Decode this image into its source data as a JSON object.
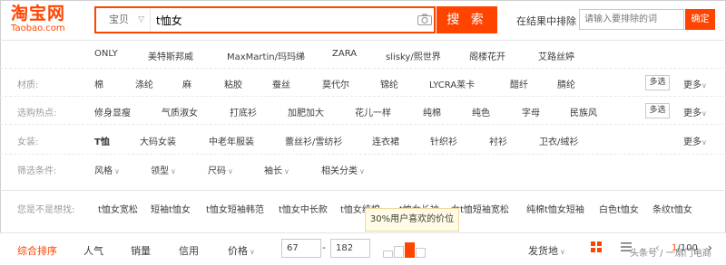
{
  "header": {
    "logo_main": "淘宝网",
    "logo_sub": "Taobao.com",
    "scope": "宝贝",
    "query": "t恤女",
    "search_label": "搜 索",
    "exclude_label": "在结果中排除",
    "exclude_placeholder": "请输入要排除的词",
    "exclude_confirm": "确定"
  },
  "brands": [
    "ONLY",
    "美特斯邦威",
    "MaxMartin/玛玛绨",
    "ZARA",
    "slisky/熙世界",
    "阁楼花开",
    "艾路丝婷"
  ],
  "material": {
    "label": "材质:",
    "items": [
      "棉",
      "涤纶",
      "麻",
      "粘胶",
      "蚕丝",
      "莫代尔",
      "锦纶",
      "LYCRA莱卡",
      "醋纤",
      "腈纶"
    ],
    "multi": "多选",
    "more": "更多"
  },
  "hot": {
    "label": "选购热点:",
    "items": [
      "修身显瘦",
      "气质淑女",
      "打底衫",
      "加肥加大",
      "花儿一样",
      "纯棉",
      "纯色",
      "字母",
      "民族风"
    ],
    "multi": "多选",
    "more": "更多"
  },
  "womens": {
    "label": "女装:",
    "items": [
      "T恤",
      "大码女装",
      "中老年服装",
      "蕾丝衫/雪纺衫",
      "连衣裙",
      "针织衫",
      "衬衫",
      "卫衣/绒衫"
    ],
    "more": "更多"
  },
  "conditions": {
    "label": "筛选条件:",
    "items": [
      "风格",
      "领型",
      "尺码",
      "袖长",
      "相关分类"
    ]
  },
  "suggest": {
    "label": "您是不是想找:",
    "items": [
      "t恤女宽松",
      "短袖t恤女",
      "t恤女短袖韩范",
      "t恤女中长款",
      "t恤女纯棉",
      "t恤女长袖",
      "女t恤短袖宽松",
      "纯棉t恤女短袖",
      "白色t恤女",
      "条纹t恤女"
    ]
  },
  "tooltip": "30%用户喜欢的价位",
  "sort": {
    "items": [
      "综合排序",
      "人气",
      "销量",
      "信用",
      "价格"
    ],
    "price_min": "67",
    "price_max": "182",
    "price_dash": "-",
    "ship_from": "发货地",
    "page_current": "1",
    "page_total": "/100",
    "price_dist_selected_index": 2
  },
  "watermark": "头条号 / 一扇门电商",
  "colors": {
    "accent": "#ff4400"
  }
}
